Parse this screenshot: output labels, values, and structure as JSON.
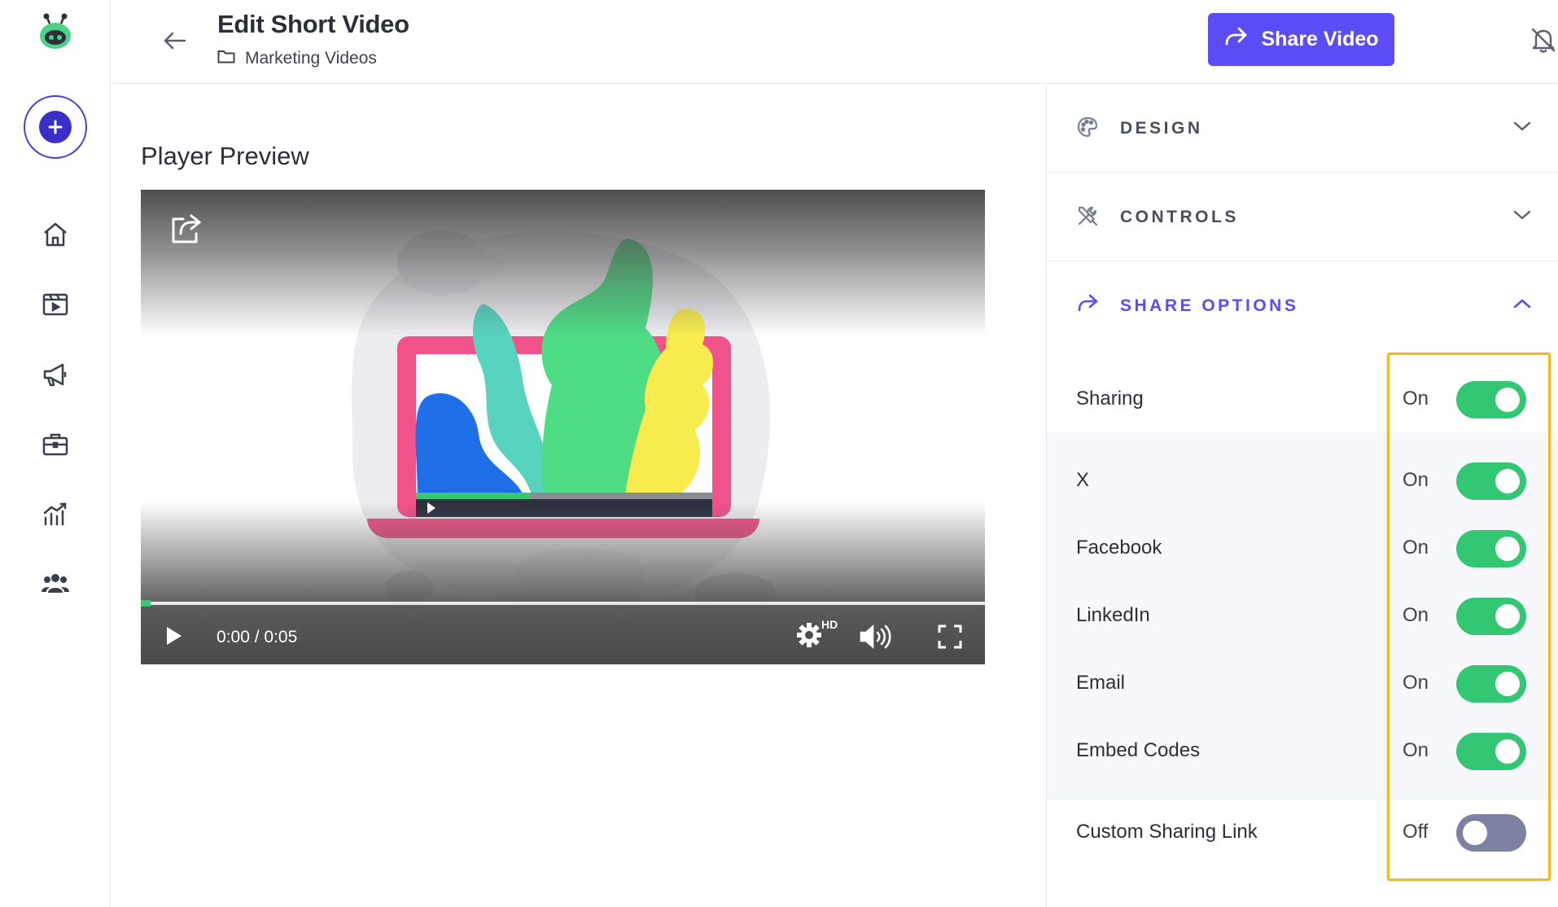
{
  "header": {
    "title": "Edit Short Video",
    "breadcrumb": "Marketing Videos",
    "share_button": "Share Video"
  },
  "main": {
    "preview_title": "Player Preview",
    "player": {
      "time": "0:00 / 0:05",
      "quality_badge": "HD",
      "progress_fraction": 0.01
    }
  },
  "panel": {
    "sections": [
      {
        "label": "DESIGN",
        "icon": "palette-icon",
        "expanded": false
      },
      {
        "label": "CONTROLS",
        "icon": "tools-icon",
        "expanded": false
      },
      {
        "label": "SHARE OPTIONS",
        "icon": "share-arrow-icon",
        "expanded": true
      }
    ],
    "share_options": [
      {
        "label": "Sharing",
        "state": "On",
        "on": true
      },
      {
        "label": "X",
        "state": "On",
        "on": true
      },
      {
        "label": "Facebook",
        "state": "On",
        "on": true
      },
      {
        "label": "LinkedIn",
        "state": "On",
        "on": true
      },
      {
        "label": "Email",
        "state": "On",
        "on": true
      },
      {
        "label": "Embed Codes",
        "state": "On",
        "on": true
      },
      {
        "label": "Custom Sharing Link",
        "state": "Off",
        "on": false
      }
    ]
  },
  "colors": {
    "accent": "#5b4cf5",
    "toggle_on": "#33c773",
    "toggle_off": "#7d82a3",
    "highlight": "#f2b821"
  }
}
